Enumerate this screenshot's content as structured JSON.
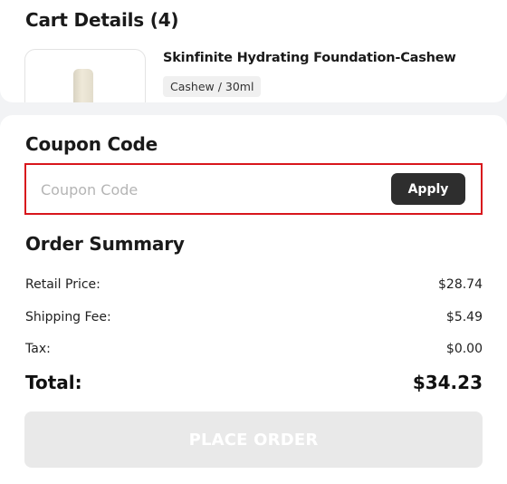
{
  "cart": {
    "title": "Cart Details (4)",
    "item": {
      "name": "Skinfinite Hydrating Foundation-Cashew",
      "variant": "Cashew / 30ml"
    }
  },
  "coupon": {
    "title": "Coupon Code",
    "placeholder": "Coupon Code",
    "apply_label": "Apply"
  },
  "summary": {
    "title": "Order Summary",
    "retail_label": "Retail Price:",
    "retail_value": "$28.74",
    "shipping_label": "Shipping Fee:",
    "shipping_value": "$5.49",
    "tax_label": "Tax:",
    "tax_value": "$0.00",
    "total_label": "Total:",
    "total_value": "$34.23"
  },
  "actions": {
    "place_order_label": "PLACE ORDER"
  },
  "colors": {
    "highlight": "#d8161c",
    "apply_bg": "#2e2e2e",
    "disabled_bg": "#e9e9e9"
  }
}
